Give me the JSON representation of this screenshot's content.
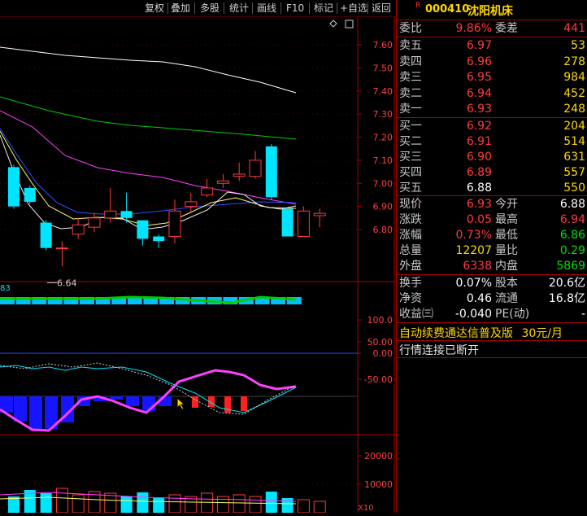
{
  "toolbar": {
    "items": [
      "复权",
      "叠加",
      "多股",
      "统计",
      "画线",
      "F10",
      "标记",
      "+自选",
      "返回"
    ]
  },
  "stock": {
    "flag": "R",
    "code": "000410",
    "name": "沈阳机床"
  },
  "quote": {
    "weibi_label": "委比",
    "weibi_value": "9.86%",
    "weicha_label": "委差",
    "weicha_value": "441",
    "sell": [
      {
        "label": "卖五",
        "price": "6.97",
        "vol": "53"
      },
      {
        "label": "卖四",
        "price": "6.96",
        "vol": "278"
      },
      {
        "label": "卖三",
        "price": "6.95",
        "vol": "984"
      },
      {
        "label": "卖二",
        "price": "6.94",
        "vol": "452"
      },
      {
        "label": "卖一",
        "price": "6.93",
        "vol": "248"
      }
    ],
    "buy": [
      {
        "label": "买一",
        "price": "6.92",
        "vol": "204"
      },
      {
        "label": "买二",
        "price": "6.91",
        "vol": "514"
      },
      {
        "label": "买三",
        "price": "6.90",
        "vol": "631"
      },
      {
        "label": "买四",
        "price": "6.89",
        "vol": "557"
      },
      {
        "label": "买五",
        "price": "6.88",
        "vol": "550"
      }
    ],
    "stats": [
      {
        "l1": "现价",
        "v1": "6.93",
        "l2": "今开",
        "v2": "6.88"
      },
      {
        "l1": "涨跌",
        "v1": "0.05",
        "l2": "最高",
        "v2": "6.94"
      },
      {
        "l1": "涨幅",
        "v1": "0.73%",
        "l2": "最低",
        "v2": "6.86"
      },
      {
        "l1": "总量",
        "v1": "12207",
        "l2": "量比",
        "v2": "0.29"
      },
      {
        "l1": "外盘",
        "v1": "6338",
        "l2": "内盘",
        "v2": "5869"
      }
    ],
    "finance": [
      {
        "l1": "换手",
        "v1": "0.07%",
        "l2": "股本",
        "v2": "20.6亿"
      },
      {
        "l1": "净资",
        "v1": "0.46",
        "l2": "流通",
        "v2": "16.8亿"
      },
      {
        "l1": "收益㈢",
        "v1": "-0.040",
        "l2": "PE(动)",
        "v2": "-"
      }
    ],
    "ad_text": "自动续费通达信普及版",
    "ad_price": "30元/月",
    "status_text": "行情连接已断开"
  },
  "price_axis": [
    "7.60",
    "7.50",
    "7.40",
    "7.30",
    "7.20",
    "7.10",
    "7.00",
    "6.90",
    "6.80"
  ],
  "low_marker": "6.64",
  "ind1_label": "83",
  "ind1_axis": [
    "100.0",
    "50.00"
  ],
  "ind2_axis": [
    "0.00",
    "-50.00"
  ],
  "vol_axis": [
    "20000",
    "10000"
  ],
  "vol_unit": "X10",
  "colors": {
    "up": "#ff3b3b",
    "down": "#00e5ff",
    "ma_white": "#ffffff",
    "ma_yellow": "#ffff66",
    "ma_magenta": "#ff40ff",
    "ma_green": "#00cc00",
    "ma_blue": "#3050ff"
  },
  "chart_data": {
    "type": "candlestick",
    "candles": [
      {
        "o": 7.07,
        "c": 6.9,
        "h": 7.08,
        "l": 6.89
      },
      {
        "o": 6.98,
        "c": 6.92,
        "h": 6.99,
        "l": 6.91
      },
      {
        "o": 6.83,
        "c": 6.72,
        "h": 6.84,
        "l": 6.71
      },
      {
        "o": 6.72,
        "c": 6.72,
        "h": 6.75,
        "l": 6.64
      },
      {
        "o": 6.78,
        "c": 6.82,
        "h": 6.85,
        "l": 6.76
      },
      {
        "o": 6.81,
        "c": 6.85,
        "h": 6.87,
        "l": 6.79
      },
      {
        "o": 6.85,
        "c": 6.88,
        "h": 6.98,
        "l": 6.83
      },
      {
        "o": 6.88,
        "c": 6.85,
        "h": 6.96,
        "l": 6.83
      },
      {
        "o": 6.84,
        "c": 6.76,
        "h": 6.84,
        "l": 6.73
      },
      {
        "o": 6.77,
        "c": 6.75,
        "h": 6.78,
        "l": 6.72
      },
      {
        "o": 6.77,
        "c": 6.88,
        "h": 6.93,
        "l": 6.74
      },
      {
        "o": 6.9,
        "c": 6.92,
        "h": 6.96,
        "l": 6.87
      },
      {
        "o": 6.95,
        "c": 6.98,
        "h": 7.02,
        "l": 6.94
      },
      {
        "o": 7.0,
        "c": 7.01,
        "h": 7.04,
        "l": 6.98
      },
      {
        "o": 7.03,
        "c": 7.04,
        "h": 7.09,
        "l": 7.01
      },
      {
        "o": 7.03,
        "c": 7.1,
        "h": 7.14,
        "l": 7.02
      },
      {
        "o": 7.16,
        "c": 6.94,
        "h": 7.17,
        "l": 6.93
      },
      {
        "o": 6.89,
        "c": 6.77,
        "h": 6.89,
        "l": 6.77
      },
      {
        "o": 6.77,
        "c": 6.88,
        "h": 6.9,
        "l": 6.77
      },
      {
        "o": 6.86,
        "c": 6.87,
        "h": 6.89,
        "l": 6.81
      }
    ]
  }
}
